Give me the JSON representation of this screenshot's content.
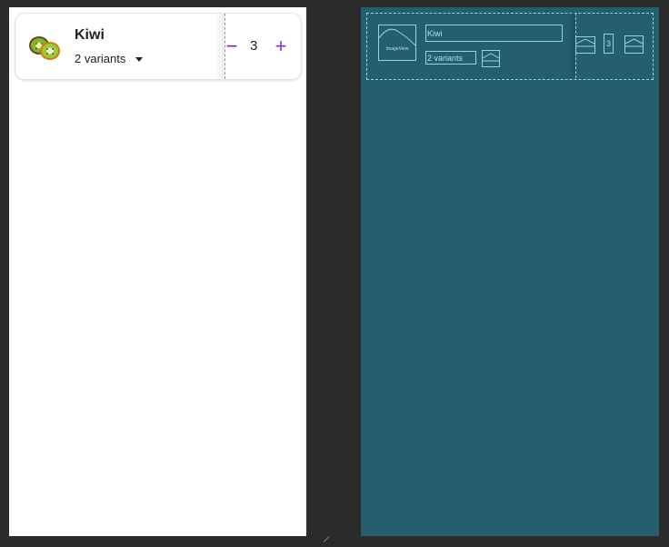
{
  "item": {
    "name": "Kiwi",
    "variants_label": "2 variants",
    "quantity": "3",
    "minus_label": "−",
    "plus_label": "+"
  },
  "blueprint": {
    "image_label": "ImageView",
    "name": "Kiwi",
    "variants_label": "2 variants",
    "quantity": "3"
  },
  "colors": {
    "accent": "#7b1fa2",
    "blueprint_bg": "#255e6e",
    "blueprint_line": "#8fd5e8",
    "canvas_bg": "#2b2b2b"
  },
  "icons": {
    "thumbnail": "kiwi-image",
    "dropdown": "arrow-drop-down-icon"
  }
}
